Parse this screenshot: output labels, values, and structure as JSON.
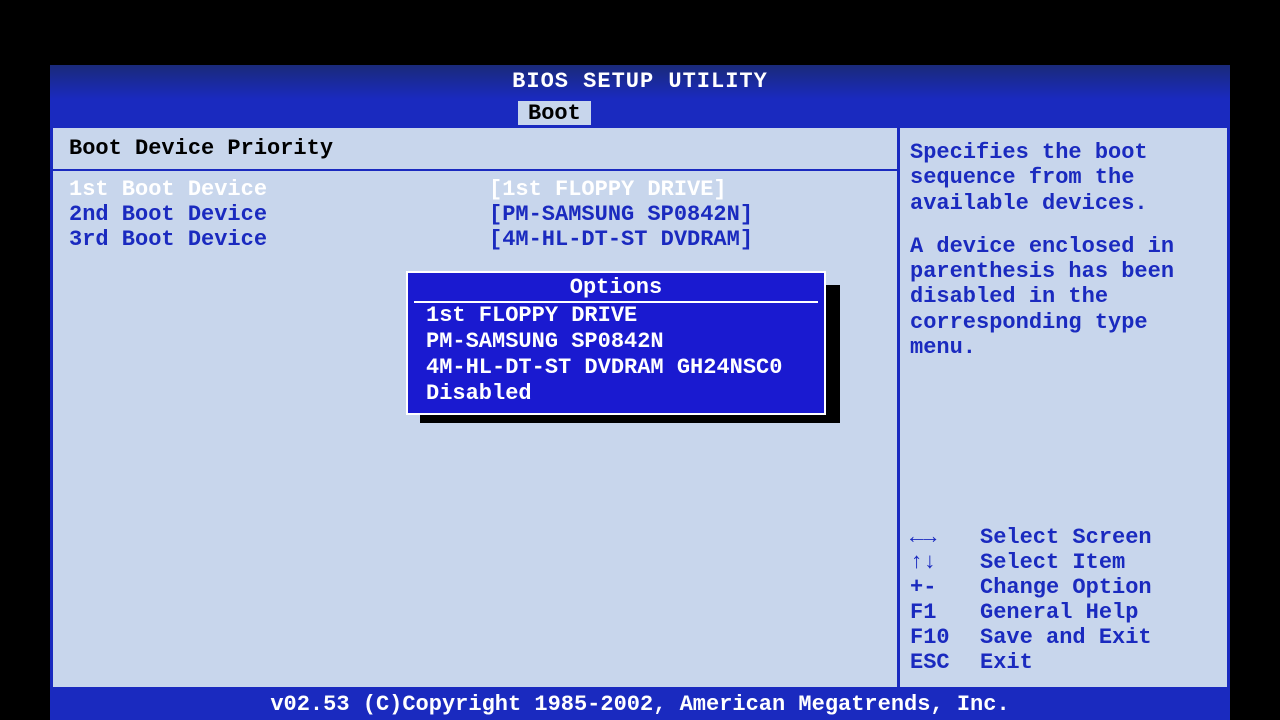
{
  "header": {
    "title": "BIOS SETUP UTILITY",
    "tab": "Boot"
  },
  "left": {
    "section_title": "Boot Device Priority",
    "rows": [
      {
        "label": "1st Boot Device",
        "value": "[1st FLOPPY DRIVE]"
      },
      {
        "label": "2nd Boot Device",
        "value": "[PM-SAMSUNG SP0842N]"
      },
      {
        "label": "3rd Boot Device",
        "value": "[4M-HL-DT-ST DVDRAM]"
      }
    ]
  },
  "popup": {
    "title": "Options",
    "items": [
      "1st FLOPPY DRIVE",
      "PM-SAMSUNG SP0842N",
      "4M-HL-DT-ST DVDRAM GH24NSC0",
      "Disabled"
    ]
  },
  "help": {
    "p1": "Specifies the boot sequence from the available devices.",
    "p2": "A device enclosed in parenthesis has been disabled in the corresponding type menu."
  },
  "keys": [
    {
      "k": "←→",
      "d": "Select Screen"
    },
    {
      "k": "↑↓",
      "d": "Select Item"
    },
    {
      "k": "+-",
      "d": "Change Option"
    },
    {
      "k": "F1",
      "d": "General Help"
    },
    {
      "k": "F10",
      "d": "Save and Exit"
    },
    {
      "k": "ESC",
      "d": "Exit"
    }
  ],
  "footer": "v02.53 (C)Copyright 1985-2002, American Megatrends, Inc."
}
